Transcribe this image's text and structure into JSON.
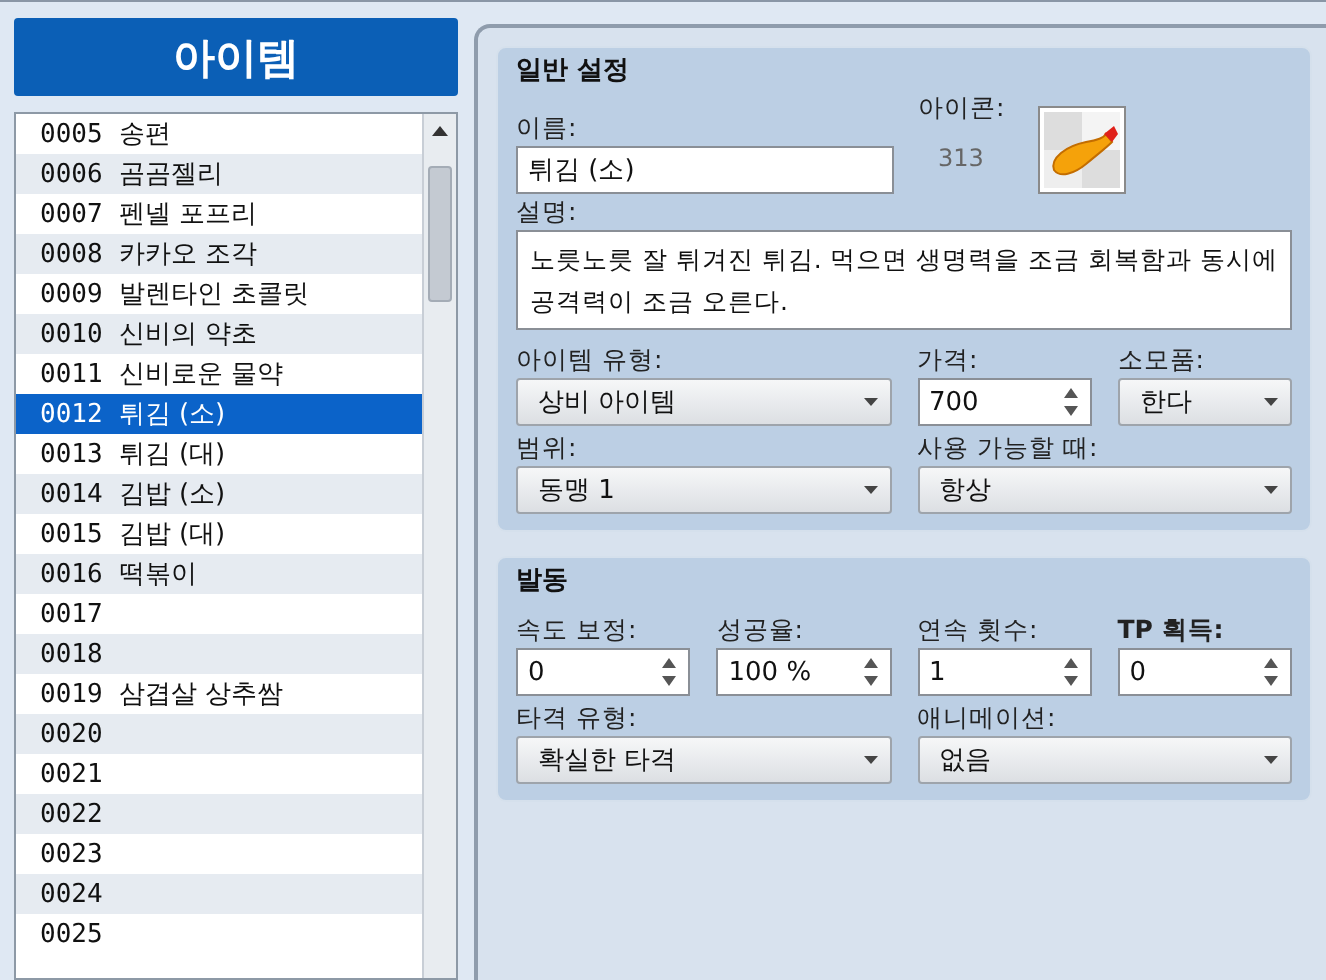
{
  "sidebar": {
    "title": "아이템",
    "items": [
      {
        "number": "0005",
        "name": "송편",
        "selected": false
      },
      {
        "number": "0006",
        "name": "곰곰젤리",
        "selected": false
      },
      {
        "number": "0007",
        "name": "펜넬 포프리",
        "selected": false
      },
      {
        "number": "0008",
        "name": "카카오 조각",
        "selected": false
      },
      {
        "number": "0009",
        "name": "발렌타인 초콜릿",
        "selected": false
      },
      {
        "number": "0010",
        "name": "신비의 약초",
        "selected": false
      },
      {
        "number": "0011",
        "name": "신비로운 물약",
        "selected": false
      },
      {
        "number": "0012",
        "name": "튀김 (소)",
        "selected": true
      },
      {
        "number": "0013",
        "name": "튀김 (대)",
        "selected": false
      },
      {
        "number": "0014",
        "name": "김밥 (소)",
        "selected": false
      },
      {
        "number": "0015",
        "name": "김밥 (대)",
        "selected": false
      },
      {
        "number": "0016",
        "name": "떡볶이",
        "selected": false
      },
      {
        "number": "0017",
        "selected": false
      },
      {
        "number": "0018",
        "selected": false
      },
      {
        "number": "0019",
        "name": "삼겹살 상추쌈",
        "selected": false
      },
      {
        "number": "0020",
        "selected": false
      },
      {
        "number": "0021",
        "selected": false
      },
      {
        "number": "0022",
        "selected": false
      },
      {
        "number": "0023",
        "selected": false
      },
      {
        "number": "0024",
        "selected": false
      },
      {
        "number": "0025",
        "selected": false
      }
    ]
  },
  "general": {
    "title": "일반 설정",
    "name": {
      "label": "이름:",
      "value": "튀김 (소)"
    },
    "icon": {
      "label": "아이콘:",
      "index": "313"
    },
    "description": {
      "label": "설명:",
      "value": "노릇노릇 잘 튀겨진 튀김. 먹으면 생명력을 조금 회복함과 동시에 공격력이 조금 오른다."
    },
    "fields": [
      {
        "kind": "select",
        "wide": true,
        "label": "아이템 유형:",
        "value": "상비 아이템"
      },
      {
        "kind": "spin",
        "wide": false,
        "label": "가격:",
        "value": "700"
      },
      {
        "kind": "select",
        "wide": false,
        "label": "소모품:",
        "value": "한다"
      },
      {
        "kind": "select",
        "wide": true,
        "label": "범위:",
        "value": "동맹 1"
      },
      {
        "kind": "select",
        "wide": true,
        "label": "사용 가능할 때:",
        "value": "항상"
      }
    ]
  },
  "invocation": {
    "title": "발동",
    "fields": [
      {
        "kind": "spin",
        "wide": false,
        "label": "속도 보정:",
        "value": "0"
      },
      {
        "kind": "spin",
        "wide": false,
        "label": "성공율:",
        "value": "100 %"
      },
      {
        "kind": "spin",
        "wide": false,
        "label": "연속 횟수:",
        "value": "1"
      },
      {
        "kind": "spin",
        "wide": false,
        "label": "TP 획득:",
        "value": "0"
      },
      {
        "kind": "select",
        "wide": true,
        "label": "타격 유형:",
        "value": "확실한 타격"
      },
      {
        "kind": "select",
        "wide": true,
        "label": "애니메이션:",
        "value": "없음"
      }
    ]
  }
}
